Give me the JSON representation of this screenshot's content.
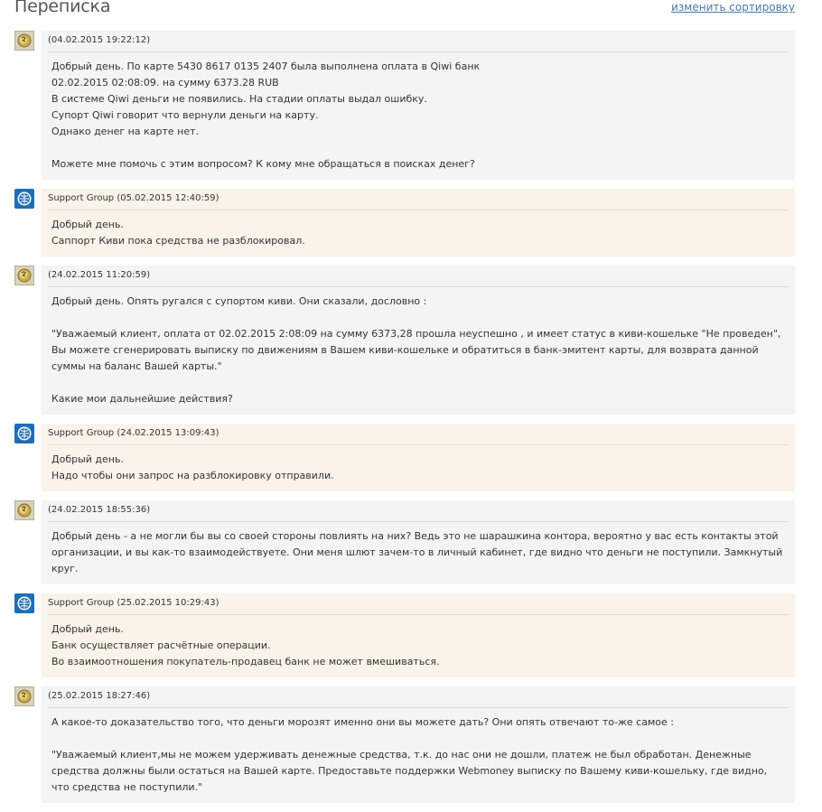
{
  "page": {
    "title": "Переписка",
    "sort_link": "изменить сортировку"
  },
  "colors": {
    "user_bg": "#f4f4f4",
    "support_bg": "#faf3ea",
    "link": "#4a78a8",
    "support_icon": "#1f6eb5",
    "user_icon": "#b0a070"
  },
  "messages": [
    {
      "role": "user",
      "avatar_icon": "user-coin-icon",
      "header": "(04.02.2015 19:22:12)",
      "lines": [
        "Добрый день. По карте 5430 8617 0135 2407 была выполнена оплата в Qiwi банк",
        "02.02.2015 02:08:09. на сумму 6373.28 RUB",
        "В системе Qiwi деньги не появились. На стадии оплаты выдал ошибку.",
        "Супорт Qiwi говорит что вернули деньги на карту.",
        "Однако денег на карте нет.",
        "",
        "Можете мне помочь с этим вопросом? К кому мне обращаться в поисках денег?"
      ]
    },
    {
      "role": "support",
      "avatar_icon": "webmoney-globe-icon",
      "header": "Support Group (05.02.2015 12:40:59)",
      "lines": [
        "Добрый день.",
        "Саппорт Киви пока средства не разблокировал."
      ]
    },
    {
      "role": "user",
      "avatar_icon": "user-coin-icon",
      "header": "(24.02.2015 11:20:59)",
      "lines": [
        "Добрый день. Опять ругался с супортом киви. Они сказали, дословно :",
        "",
        "\"Уважаемый клиент, оплата от 02.02.2015 2:08:09 на сумму 6373,28 прошла неуспешно , и имеет статус в киви-кошельке \"Не проведен\", Вы можете сгенерировать выписку по движениям в Вашем киви-кошельке и обратиться в банк-эмитент карты, для возврата данной суммы на баланс Вашей карты.\"",
        "",
        "Какие мои дальнейшие действия?"
      ]
    },
    {
      "role": "support",
      "avatar_icon": "webmoney-globe-icon",
      "header": "Support Group (24.02.2015 13:09:43)",
      "lines": [
        "Добрый день.",
        "Надо чтобы они запрос на разблокировку отправили."
      ]
    },
    {
      "role": "user",
      "avatar_icon": "user-coin-icon",
      "header": "(24.02.2015 18:55:36)",
      "lines": [
        "Добрый день - а не могли бы вы со своей стороны повлиять на них? Ведь это не шарашкина контора, вероятно у вас есть контакты этой организации, и вы как-то взаимодействуете. Они меня шлют зачем-то в личный кабинет, где видно что деньги не поступили. Замкнутый круг."
      ]
    },
    {
      "role": "support",
      "avatar_icon": "webmoney-globe-icon",
      "header": "Support Group (25.02.2015 10:29:43)",
      "lines": [
        "Добрый день.",
        "Банк осуществляет расчётные операции.",
        "Во взаимоотношения покупатель-продавец банк не может вмешиваться."
      ]
    },
    {
      "role": "user",
      "avatar_icon": "user-coin-icon",
      "header": "(25.02.2015 18:27:46)",
      "lines": [
        "А какое-то доказательство того, что деньги морозят именно они вы можете дать? Они опять отвечают то-же самое :",
        "",
        "\"Уважаемый клиент,мы не можем удерживать денежные средства, т.к. до нас они не дошли, платеж не был обработан. Денежные средства должны были остаться на Вашей карте. Предоставьте поддержки Webmoney выписку по Вашему киви-кошельку, где видно, что средства не поступили.\""
      ]
    }
  ]
}
